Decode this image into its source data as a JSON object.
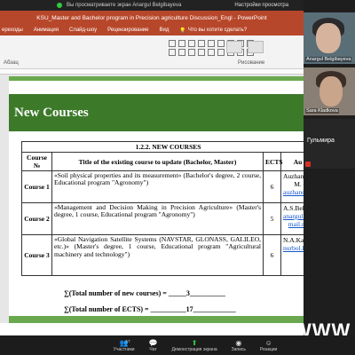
{
  "zoom": {
    "viewing_text": "Вы просматриваете экран Anargul Belgibayeva",
    "view_options": "Настройки просмотра",
    "toolbar": [
      {
        "label": "Участники",
        "icon": "participants-icon",
        "badge": "17"
      },
      {
        "label": "Чат",
        "icon": "chat-icon"
      },
      {
        "label": "Демонстрация экрана",
        "icon": "share-screen-icon"
      },
      {
        "label": "Запись",
        "icon": "record-icon"
      },
      {
        "label": "Реакции",
        "icon": "reactions-icon"
      }
    ],
    "participants": [
      {
        "name": "Anargul Belgibayeva"
      },
      {
        "name": "Sara Kladkova"
      },
      {
        "name": "Гульмира"
      }
    ],
    "watermark": "WWW"
  },
  "ppt": {
    "window_title": "KSU_Master and Bachelor program in Precision agriculture Discussion_Engl - PowerPoint",
    "ribbon_tabs": [
      "ереходы",
      "Анимация",
      "Слайд-шоу",
      "Рецензирование",
      "Вид",
      "Что вы хотите сделать?"
    ],
    "ribbon_groups": [
      "Абзац",
      "Рисование"
    ]
  },
  "slide": {
    "title": "New Courses",
    "table_caption": "1.2.2. NEW COURSES",
    "headers": [
      "Course №",
      "Title of the existing course to update (Bachelor, Master)",
      "ECTS",
      "Au"
    ],
    "rows": [
      {
        "num": "Course 1",
        "title": "«Soil physical properties and its measurement» (Bachelor's degree, 2 course, Educational program \"Agronomy\")",
        "ects": "6",
        "author_name": "Auzhanova M.",
        "author_email": "auzhanovam@"
      },
      {
        "num": "Course 2",
        "title": "«Management and Decision Making in Precision Agriculture» (Master's degree, 1 course, Educational program \"Agronomy\")",
        "ects": "5",
        "author_name": "A.S.Belgibaev",
        "author_email": "anargul.belgibaeva",
        "author_email2": "mail.ru"
      },
      {
        "num": "Course 3",
        "title": "«Global Navigation Satellite Systems (NAVSTAR, GLONASS, GALILEO, etc.)» (Master's degree, 1 course, Educational program \"Agricultural machinery and technology\")",
        "ects": "6",
        "author_name": "N.A.Kakabayev",
        "author_email": "nurbol.ka@mail"
      }
    ],
    "total_courses": "∑(Total number of new courses) = _____3__________",
    "total_ects": "∑(Total number of ECTS) = __________17____________"
  },
  "colors": {
    "ppt_accent": "#b7472a",
    "slide_band": "#3c7a2a",
    "slide_bar": "#6aa84f",
    "share_green": "#2ecc40",
    "muted_red": "#d93025"
  }
}
